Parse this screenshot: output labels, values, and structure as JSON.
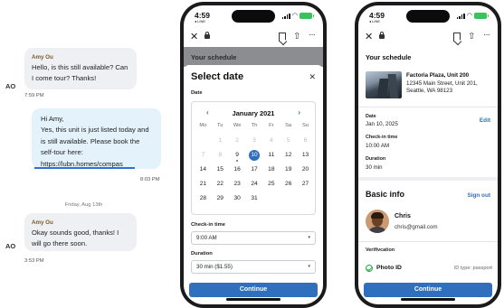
{
  "chat": {
    "msg1": {
      "sender": "Amy Ou",
      "avatar": "AO",
      "text": "Hello, is this still available? Can I come tour? Thanks!",
      "time": "7:59 PM"
    },
    "msg2": {
      "lines": [
        "Hi Amy,",
        "Yes, this unit is just listed today and is still available.  Please book the self-tour here:"
      ],
      "link": "https://lubn.homes/compas",
      "time": "8:03 PM"
    },
    "day_separator": "Friday, Aug 13th",
    "msg3": {
      "sender": "Amy Ou",
      "avatar": "AO",
      "text": "Okay sounds good, thanks! I will go there soon.",
      "time": "3:53 PM"
    }
  },
  "status": {
    "time": "4:59",
    "carrier": "◂ LINE"
  },
  "browser": {
    "close": "✕",
    "share": "⇧",
    "more": "···"
  },
  "select_date": {
    "backdrop_title": "Your schedule",
    "title": "Select date",
    "close": "✕",
    "date_label": "Date",
    "month": "January 2021",
    "prev": "‹",
    "next": "›",
    "weekdays": [
      "Mo",
      "Tu",
      "We",
      "Th",
      "Fr",
      "Sa",
      "Su"
    ],
    "days": [
      {
        "d": "",
        "s": ""
      },
      {
        "d": "1",
        "s": "dis"
      },
      {
        "d": "2",
        "s": "dis"
      },
      {
        "d": "3",
        "s": "dis"
      },
      {
        "d": "4",
        "s": "dis"
      },
      {
        "d": "5",
        "s": "dis"
      },
      {
        "d": "6",
        "s": "dis"
      },
      {
        "d": "7",
        "s": "dis"
      },
      {
        "d": "8",
        "s": "dis"
      },
      {
        "d": "9",
        "s": "today"
      },
      {
        "d": "10",
        "s": "sel"
      },
      {
        "d": "11",
        "s": ""
      },
      {
        "d": "12",
        "s": ""
      },
      {
        "d": "13",
        "s": ""
      },
      {
        "d": "14",
        "s": ""
      },
      {
        "d": "15",
        "s": ""
      },
      {
        "d": "16",
        "s": ""
      },
      {
        "d": "17",
        "s": ""
      },
      {
        "d": "18",
        "s": ""
      },
      {
        "d": "19",
        "s": ""
      },
      {
        "d": "20",
        "s": ""
      },
      {
        "d": "21",
        "s": ""
      },
      {
        "d": "22",
        "s": ""
      },
      {
        "d": "23",
        "s": ""
      },
      {
        "d": "24",
        "s": ""
      },
      {
        "d": "25",
        "s": ""
      },
      {
        "d": "26",
        "s": ""
      },
      {
        "d": "27",
        "s": ""
      },
      {
        "d": "28",
        "s": ""
      },
      {
        "d": "29",
        "s": ""
      },
      {
        "d": "30",
        "s": ""
      },
      {
        "d": "31",
        "s": ""
      }
    ],
    "checkin_label": "Check-in time",
    "checkin_value": "9:00 AM",
    "duration_label": "Duration",
    "duration_value": "30 min ($1.55)",
    "caret": "▾",
    "continue": "Continue"
  },
  "schedule": {
    "title": "Your schedule",
    "property_name": "Factoria Plaza, Unit 200",
    "property_address": "12345 Main Street, Unit 201, Seattle, WA 98123",
    "date_label": "Date",
    "date_value": "Jan 10, 2025",
    "edit": "Edit",
    "checkin_label": "Check-in time",
    "checkin_value": "10:00 AM",
    "duration_label": "Duration",
    "duration_value": "30 min",
    "basic_info": "Basic info",
    "sign_out": "Sign out",
    "user_name": "Chris",
    "user_email": "chris@gmail.com",
    "verification_label": "Verifivcation",
    "photo_id": "Photo ID",
    "id_type": "ID type: passport",
    "continue": "Continue"
  },
  "colors": {
    "accent": "#2f6fbd",
    "link_underline": "#2f6fd6",
    "incoming_bubble": "#eef0f3",
    "outgoing_bubble": "#e3f2fb",
    "verified": "#2da44e"
  }
}
